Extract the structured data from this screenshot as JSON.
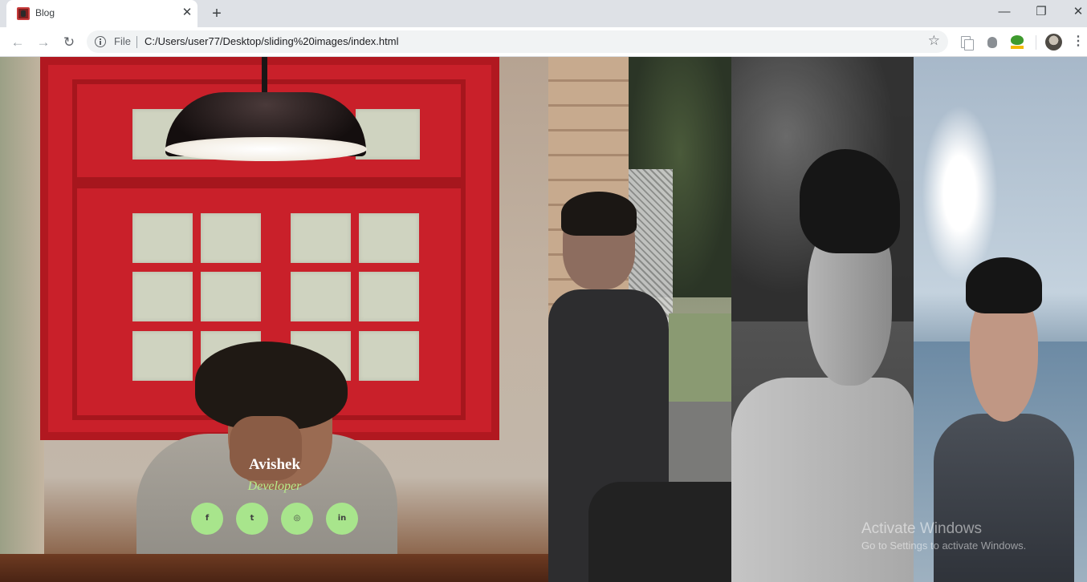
{
  "browser": {
    "tab_title": "Blog",
    "tab_close": "✕",
    "new_tab": "+",
    "url_scheme": "File",
    "url": "C:/Users/user77/Desktop/sliding%20images/index.html",
    "window_controls": {
      "minimize": "—",
      "maximize": "❐",
      "close": "✕"
    },
    "nav": {
      "back": "←",
      "forward": "→",
      "reload": "↻"
    },
    "star": "☆",
    "menu": "⋮",
    "icons": [
      "info-icon",
      "star-icon",
      "extension-copy-icon",
      "extension-bug-icon",
      "extension-html-icon",
      "profile-avatar",
      "menu-icon"
    ]
  },
  "gallery": {
    "panels": [
      {
        "scene": "red-window-lamp",
        "active": true
      },
      {
        "scene": "porch-fence"
      },
      {
        "scene": "trees-monochrome"
      },
      {
        "scene": "beach-sky"
      }
    ]
  },
  "profile": {
    "name": "Avishek",
    "role": "Developer",
    "name_color": "#ffffff",
    "role_color": "#b7ec8a",
    "social": [
      {
        "label": "f",
        "icon": "facebook-icon"
      },
      {
        "label": "t",
        "icon": "twitter-icon"
      },
      {
        "label": "◎",
        "icon": "instagram-icon"
      },
      {
        "label": "in",
        "icon": "linkedin-icon"
      }
    ],
    "social_bg": "#a8e58c"
  },
  "watermark": {
    "title": "Activate Windows",
    "subtitle": "Go to Settings to activate Windows."
  }
}
